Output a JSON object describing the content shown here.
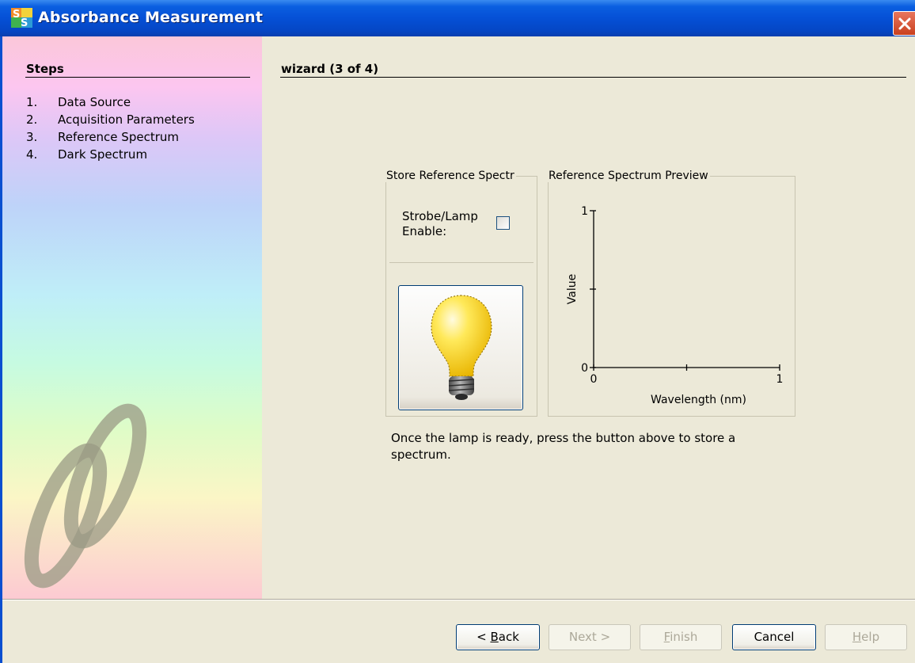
{
  "window": {
    "title": "Absorbance Measurement",
    "close_glyph": "✕"
  },
  "steps": {
    "heading": "Steps",
    "items": [
      {
        "num": "1.",
        "label": "Data Source"
      },
      {
        "num": "2.",
        "label": "Acquisition Parameters"
      },
      {
        "num": "3.",
        "label": "Reference Spectrum"
      },
      {
        "num": "4.",
        "label": "Dark Spectrum"
      }
    ]
  },
  "wizard": {
    "heading": "wizard (3 of 4)"
  },
  "store_group": {
    "legend": "Store Reference Spectr",
    "strobe_label_line1": "Strobe/Lamp",
    "strobe_label_line2": "Enable:",
    "strobe_checked": false,
    "lamp_button_icon": "light-bulb-icon"
  },
  "preview_group": {
    "legend": "Reference Spectrum Preview"
  },
  "chart_data": {
    "type": "line",
    "title": "",
    "xlabel": "Wavelength (nm)",
    "ylabel": "Value",
    "xlim": [
      0,
      1
    ],
    "ylim": [
      0,
      1
    ],
    "x_ticks": [
      "0",
      "1"
    ],
    "y_ticks": [
      "0",
      "1"
    ],
    "series": []
  },
  "instruction": {
    "line1": "Once the lamp is ready, press the button above to store a",
    "line2": "spectrum."
  },
  "buttons": {
    "back": {
      "prefix": "< ",
      "mnemonic": "B",
      "rest": "ack"
    },
    "next": {
      "label": "Next >"
    },
    "finish": {
      "mnemonic": "F",
      "rest": "inish"
    },
    "cancel": {
      "label": "Cancel"
    },
    "help": {
      "mnemonic": "H",
      "rest": "elp"
    }
  },
  "colors": {
    "title_bar": "#0550d6",
    "close_button": "#d24f2c",
    "dialog_bg": "#ece9d8",
    "bulb": "#ffe14a"
  }
}
